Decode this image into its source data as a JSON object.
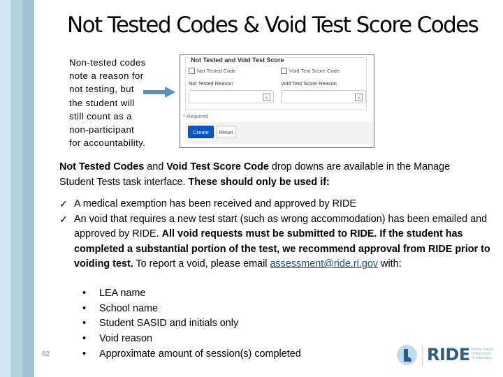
{
  "slide": {
    "title": "Not Tested Codes & Void Test Score Codes",
    "page_number": "82"
  },
  "side_note": {
    "lines": [
      "Non-tested codes",
      "note a reason for",
      "not testing, but",
      "the student will",
      "still count as a",
      "non-participant",
      "for accountability."
    ]
  },
  "form_screenshot": {
    "legend": "Not Tested and Void Test Score",
    "not_tested_checkbox": "Not Tested Code",
    "void_checkbox": "Void Test Score Code",
    "not_tested_reason_label": "Not Tested Reason",
    "void_reason_label": "Void Test Score Reason",
    "not_tested_reason_value": "",
    "void_reason_value": "",
    "required_note": "* Required",
    "create_button": "Create",
    "reset_button": "Reset",
    "colors": {
      "primary_button": "#0b55c8"
    }
  },
  "intro": {
    "bold1": "Not Tested Codes",
    "text1": " and ",
    "bold2": "Void Test Score Code",
    "text2": " drop downs are available in the Manage Student Tests task interface. ",
    "bold3": "These should only be used if:"
  },
  "checks": [
    {
      "text": "A medical exemption has been received and approved by RIDE"
    },
    {
      "text": "An void that requires a new test start (such as wrong accommodation) has been emailed and approved by RIDE. ",
      "bold": "All void requests must be submitted to RIDE. If the student has completed a substantial portion of the test, we recommend approval from RIDE prior to voiding test.",
      "text_after": " To report a void, please email ",
      "email": "assessment@ride.ri.gov",
      "text_end": " with:"
    }
  ],
  "bullets": [
    "LEA name",
    "School name",
    "Student SASID and initials only",
    "Void reason",
    "Approximate amount of session(s) completed"
  ],
  "logo": {
    "wordmark": "RIDE",
    "sub": [
      "Rhode Island",
      "Department",
      "of Education"
    ]
  },
  "icons": {
    "check": "✓",
    "bullet": "•",
    "chevron": "⌄"
  }
}
